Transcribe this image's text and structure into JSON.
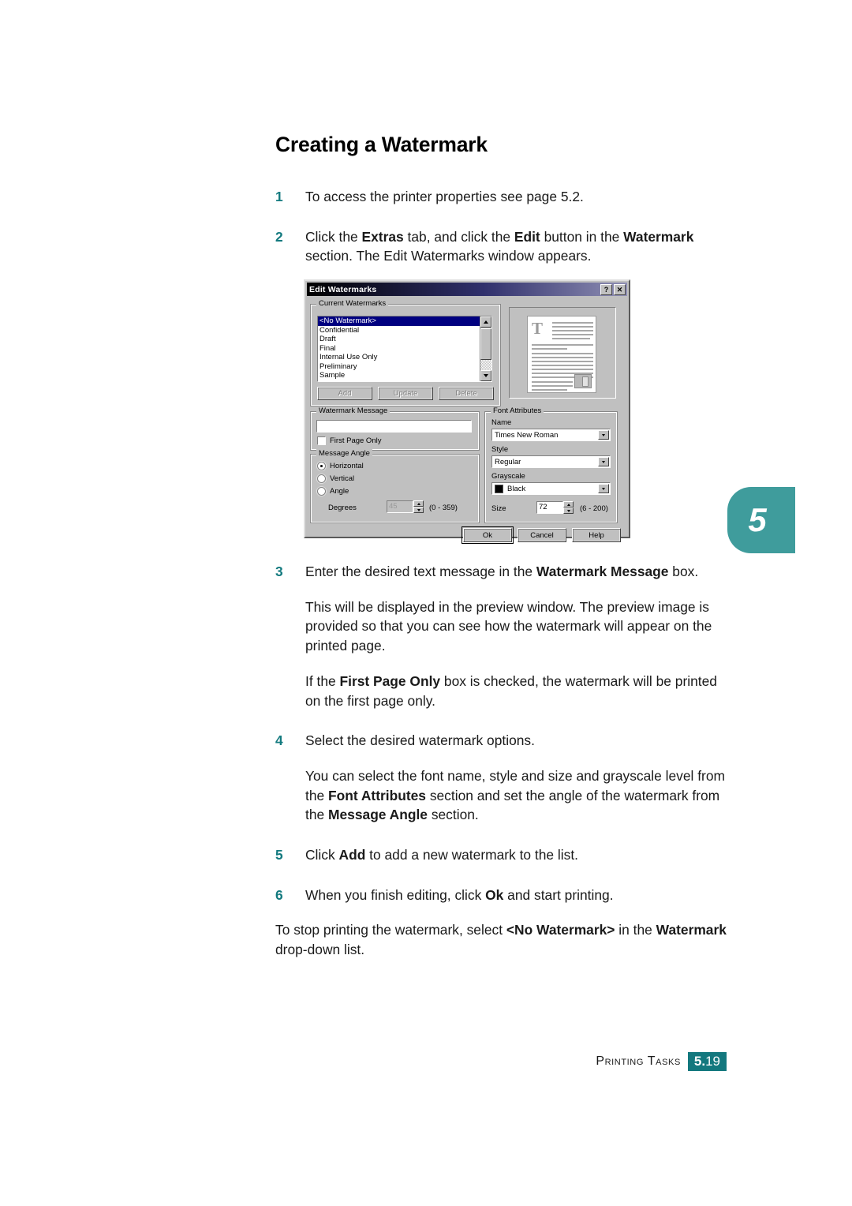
{
  "page": {
    "title": "Creating a Watermark",
    "chapter_tab": "5",
    "footer_label": "Printing Tasks",
    "footer_page_major": "5.",
    "footer_page_minor": "19",
    "accent_color": "#13787e",
    "tab_color": "#3f9c9c"
  },
  "steps": {
    "s1_num": "1",
    "s1_text": "To access the printer properties see page 5.2.",
    "s2_num": "2",
    "s2_a": "Click the ",
    "s2_b1": "Extras",
    "s2_c": " tab, and click the ",
    "s2_b2": "Edit",
    "s2_d": " button in the ",
    "s2_b3": "Watermark",
    "s2_e": " section. The Edit Watermarks window appears.",
    "s3_num": "3",
    "s3_a": "Enter the desired text message in the ",
    "s3_b1": "Watermark Message",
    "s3_c": " box.",
    "s3_p1": "This will be displayed in the preview window. The preview image is provided so that you can see how the watermark will appear on the printed page.",
    "s3_p2_a": "If the ",
    "s3_p2_b": "First Page Only",
    "s3_p2_c": " box is checked, the watermark will be printed on the first page only.",
    "s4_num": "4",
    "s4_text": "Select the desired watermark options.",
    "s4_p1_a": "You can select the font name, style and size and grayscale level from the ",
    "s4_p1_b1": "Font Attributes",
    "s4_p1_c": " section and set the angle of the watermark from the ",
    "s4_p1_b2": "Message Angle",
    "s4_p1_d": " section.",
    "s5_num": "5",
    "s5_a": "Click ",
    "s5_b": "Add",
    "s5_c": " to add a new watermark to the list.",
    "s6_num": "6",
    "s6_a": "When you finish editing, click ",
    "s6_b": "Ok",
    "s6_c": " and start printing.",
    "closing_a": "To stop printing the watermark, select ",
    "closing_b": "<No Watermark>",
    "closing_c": " in the ",
    "closing_b2": "Watermark",
    "closing_d": " drop-down list."
  },
  "dialog": {
    "title": "Edit Watermarks",
    "help_button": "?",
    "close_button": "✕",
    "current_watermarks": {
      "legend": "Current Watermarks",
      "items": [
        "<No Watermark>",
        "Confidential",
        "Draft",
        "Final",
        "Internal Use Only",
        "Preliminary",
        "Sample"
      ],
      "selected_index": 0,
      "add_label": "Add",
      "update_label": "Update",
      "delete_label": "Delete"
    },
    "watermark_message": {
      "legend": "Watermark Message",
      "value": "",
      "first_page_only_label": "First Page Only",
      "first_page_only_checked": false
    },
    "message_angle": {
      "legend": "Message Angle",
      "options": [
        "Horizontal",
        "Vertical",
        "Angle"
      ],
      "selected": "Horizontal",
      "degrees_label": "Degrees",
      "degrees_value": "45",
      "degrees_range": "(0 - 359)",
      "degrees_enabled": false
    },
    "font_attributes": {
      "legend": "Font Attributes",
      "name_label": "Name",
      "name_value": "Times New Roman",
      "style_label": "Style",
      "style_value": "Regular",
      "grayscale_label": "Grayscale",
      "grayscale_value": "Black",
      "grayscale_swatch": "#000000",
      "size_label": "Size",
      "size_value": "72",
      "size_range": "(6 - 200)"
    },
    "buttons": {
      "ok": "Ok",
      "cancel": "Cancel",
      "help": "Help"
    },
    "preview": {
      "dropcap": "T"
    }
  }
}
